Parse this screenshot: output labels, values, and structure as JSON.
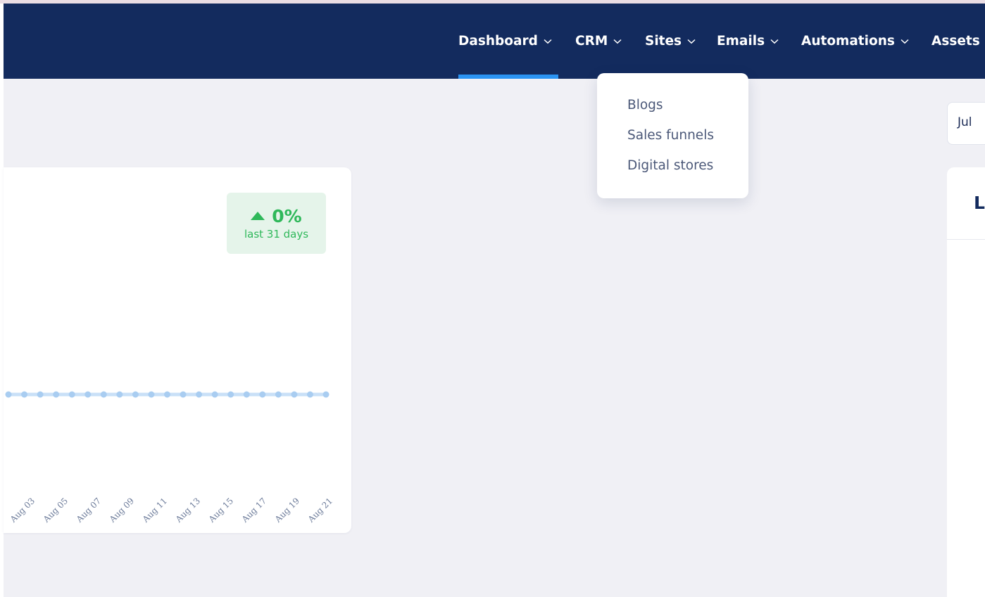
{
  "nav": {
    "items": [
      {
        "label": "Dashboard",
        "has_dropdown": true,
        "active": true
      },
      {
        "label": "CRM",
        "has_dropdown": true
      },
      {
        "label": "Sites",
        "has_dropdown": true
      },
      {
        "label": "Emails",
        "has_dropdown": true
      },
      {
        "label": "Automations",
        "has_dropdown": true
      },
      {
        "label": "Assets",
        "has_dropdown": false
      }
    ]
  },
  "sites_dropdown": {
    "items": [
      "Blogs",
      "Sales funnels",
      "Digital stores"
    ]
  },
  "date_picker": {
    "label": "Jul"
  },
  "right_panel": {
    "title": "L"
  },
  "stat_card": {
    "change_value": "0%",
    "change_direction": "up",
    "change_caption": "last 31 days"
  },
  "chart_data": {
    "type": "line",
    "x_tick_labels": [
      "Aug 03",
      "Aug 05",
      "Aug 07",
      "Aug 09",
      "Aug 11",
      "Aug 13",
      "Aug 15",
      "Aug 17",
      "Aug 19",
      "Aug 21"
    ],
    "points_visible": 21,
    "values": [
      0,
      0,
      0,
      0,
      0,
      0,
      0,
      0,
      0,
      0,
      0,
      0,
      0,
      0,
      0,
      0,
      0,
      0,
      0,
      0,
      0
    ],
    "grid": false
  },
  "colors": {
    "navbar": "#132b5e",
    "active_underline": "#2a93f2",
    "badge_green": "#2fb85a",
    "badge_bg": "#e5f4ea",
    "series_line": "#c9e0f7",
    "series_point": "#a9cdf1"
  }
}
